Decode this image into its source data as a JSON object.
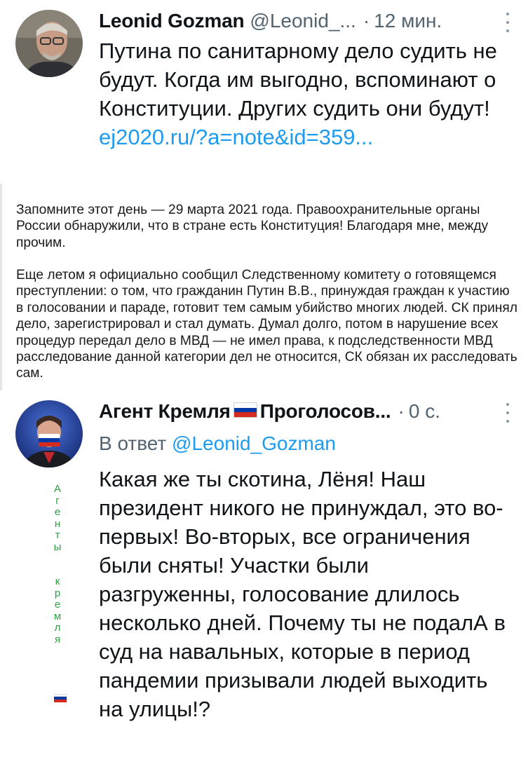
{
  "tweet1": {
    "name": "Leonid Gozman",
    "handle": "@Leonid_...",
    "separator": "·",
    "time": "12 мин.",
    "text": "Путина по санитарному дело судить не будут. Когда им выгодно, вспоминают о Конституции. Других судить они будут!",
    "link": "ej2020.ru/?a=note&id=359..."
  },
  "quote": {
    "paragraph1": "Запомните этот день — 29 марта 2021 года. Правоохранительные органы России обнаружили, что в стране есть Конституция! Благодаря мне, между прочим.",
    "paragraph2": "Еще летом я официально сообщил Следственному комитету о готовящемся преступлении: о том, что гражданин Путин В.В., принуждая граждан к участию в голосовании и параде, готовит тем самым убийство многих людей. СК принял дело, зарегистрировал и стал думать. Думал долго, потом в нарушение всех процедур передал дело в МВД — не имел права, к подследственности МВД расследование данной категории дел не относится, СК обязан их расследовать сам."
  },
  "tweet2": {
    "name_part1": "Агент Кремля",
    "name_part2": "Проголосов...",
    "separator": "·",
    "time": "0 с.",
    "reply_prefix": "В ответ",
    "reply_mention": "@Leonid_Gozman",
    "text": "Какая же ты скотина, Лёня! Наш президент никого не принуждал, это во-первых! Во-вторых, все ограничения были сняты! Участки были разгруженны, голосование длилось несколько дней. Почему ты не подалА в суд на навальных, которые в период пандемии призывали людей выходить на улицы!?",
    "vertical_letters": [
      "А",
      "г",
      "е",
      "н",
      "т",
      "ы",
      "",
      "к",
      "р",
      "е",
      "м",
      "л",
      "я"
    ]
  },
  "colors": {
    "link": "#1d9bf0",
    "secondary_text": "#536471",
    "vertical_text": "#2ea043",
    "flag": [
      "#ffffff",
      "#0039a6",
      "#d52b1e"
    ]
  },
  "icons": {
    "more": "more-vertical-icon",
    "flag": "russia-flag-icon"
  }
}
